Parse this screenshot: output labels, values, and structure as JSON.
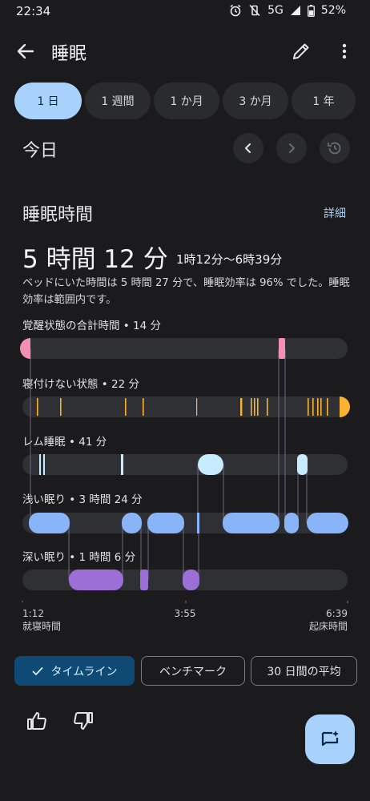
{
  "status_bar": {
    "time": "22:34",
    "network": "5G",
    "battery": "52%"
  },
  "app_bar": {
    "title": "睡眠"
  },
  "tabs": [
    {
      "label": "1 日",
      "active": true
    },
    {
      "label": "1 週間",
      "active": false
    },
    {
      "label": "1 か月",
      "active": false
    },
    {
      "label": "3 か月",
      "active": false
    },
    {
      "label": "1 年",
      "active": false
    }
  ],
  "date_nav": {
    "label": "今日"
  },
  "sleep": {
    "section_title": "睡眠時間",
    "details_link": "詳細",
    "duration": "5 時間 12 分",
    "range": "1時12分〜6時39分",
    "description": "ベッドにいた時間は 5 時間 27 分で、睡眠効率は 96% でした。睡眠効率は範囲内です。"
  },
  "chart_data": {
    "type": "timeline",
    "start": "1:12",
    "mid": "3:55",
    "end": "6:39",
    "start_label": "就寝時間",
    "end_label": "起床時間",
    "stages": [
      {
        "label": "覚醒状態の合計時間 • 14 分",
        "color": "#f48fb1"
      },
      {
        "label": "寝付けない状態 • 22 分",
        "color": "#f9b233"
      },
      {
        "label": "レム睡眠 • 41 分",
        "color": "#c7ecff"
      },
      {
        "label": "浅い眠り • 3 時間 24 分",
        "color": "#8ab4f8"
      },
      {
        "label": "深い眠り • 1 時間 6 分",
        "color": "#9b6fd6"
      }
    ]
  },
  "chips": {
    "timeline": "タイムライン",
    "benchmark": "ベンチマーク",
    "average": "30 日間の平均"
  }
}
